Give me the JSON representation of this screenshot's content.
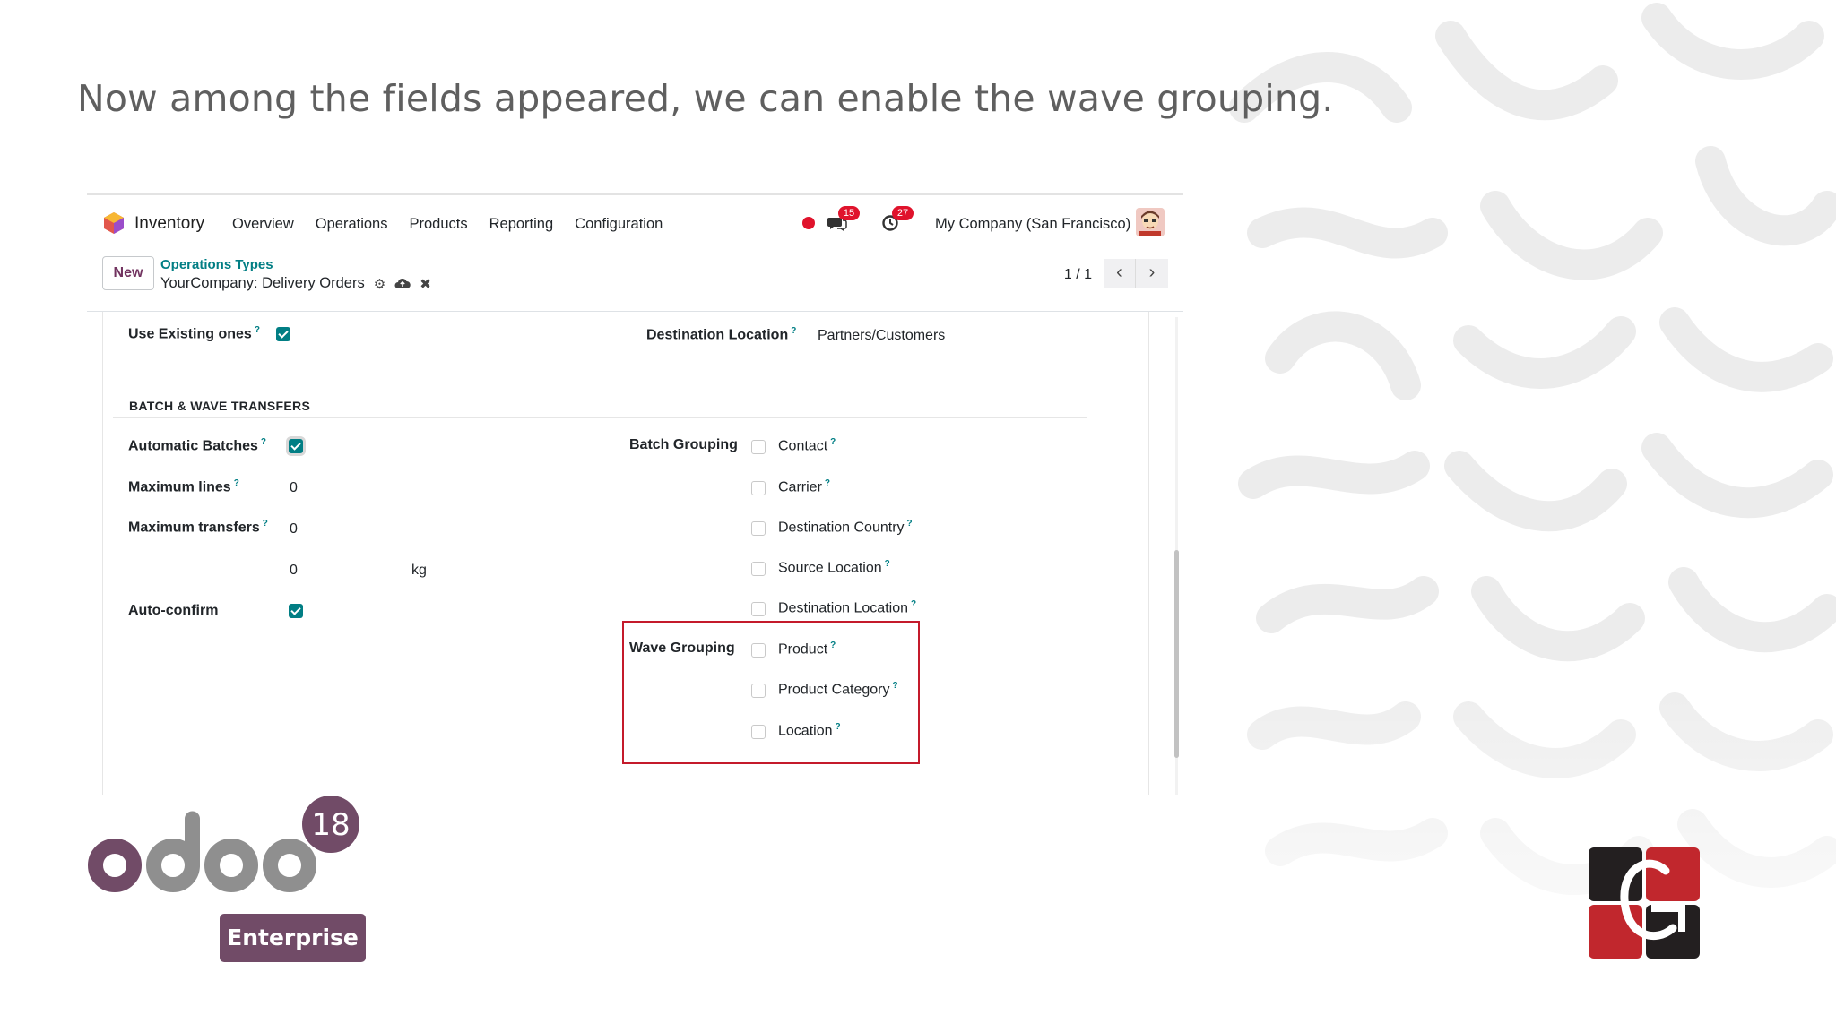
{
  "caption": "Now among the fields appeared, we can enable the wave grouping.",
  "navbar": {
    "app_name": "Inventory",
    "menu": [
      "Overview",
      "Operations",
      "Products",
      "Reporting",
      "Configuration"
    ],
    "chat_badge": "15",
    "activity_badge": "27",
    "company": "My Company (San Francisco)"
  },
  "control_panel": {
    "new_label": "New",
    "breadcrumb": "Operations Types",
    "record_title": "YourCompany: Delivery Orders",
    "pager": "1 / 1",
    "prev": "‹",
    "next": "›"
  },
  "form": {
    "use_existing_label": "Use Existing ones",
    "use_existing_checked": true,
    "dest_location_label": "Destination Location",
    "dest_location_value": "Partners/Customers",
    "section_title": "BATCH & WAVE TRANSFERS",
    "automatic_batches_label": "Automatic Batches",
    "automatic_batches_checked": true,
    "max_lines_label": "Maximum lines",
    "max_lines_value": "0",
    "max_transfers_label": "Maximum transfers",
    "max_transfers_value": "0",
    "weight_value": "0",
    "weight_unit": "kg",
    "auto_confirm_label": "Auto-confirm",
    "auto_confirm_checked": true,
    "batch_grouping_label": "Batch Grouping",
    "batch_options": [
      "Contact",
      "Carrier",
      "Destination Country",
      "Source Location",
      "Destination Location"
    ],
    "wave_grouping_label": "Wave Grouping",
    "wave_options": [
      "Product",
      "Product Category",
      "Location"
    ],
    "help_mark": "?"
  },
  "branding": {
    "odoo_version": "18",
    "edition": "Enterprise"
  },
  "colors": {
    "accent": "#017e84",
    "brand": "#714b67",
    "highlight": "#c41a2b"
  }
}
